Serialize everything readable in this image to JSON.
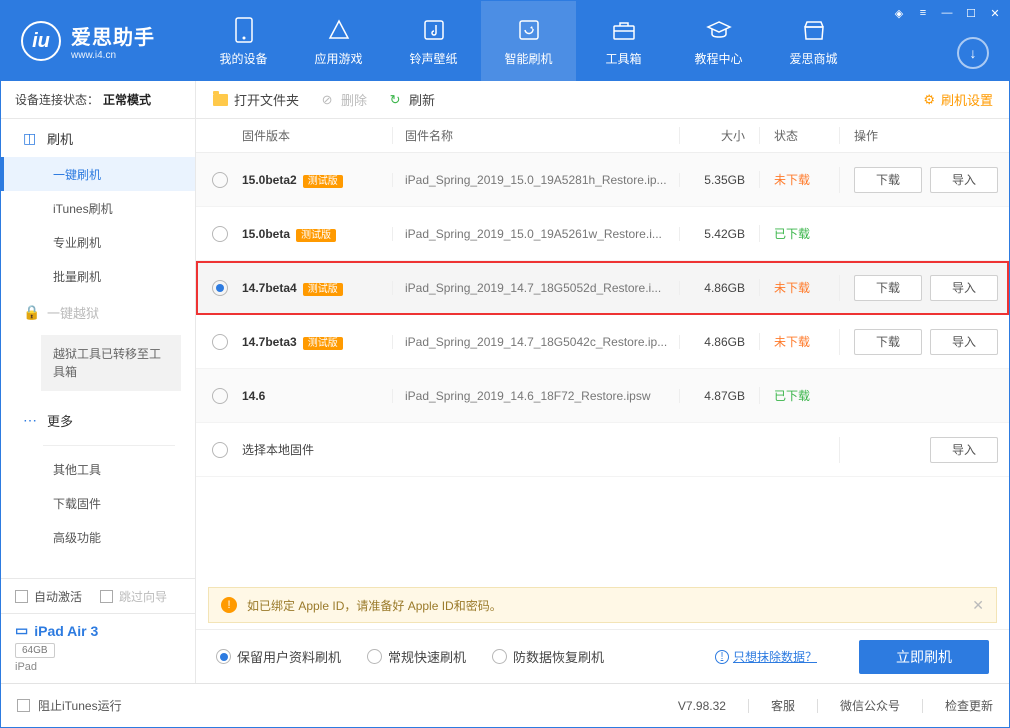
{
  "brand": {
    "title": "爱思助手",
    "subtitle": "www.i4.cn"
  },
  "nav": {
    "items": [
      {
        "label": "我的设备"
      },
      {
        "label": "应用游戏"
      },
      {
        "label": "铃声壁纸"
      },
      {
        "label": "智能刷机"
      },
      {
        "label": "工具箱"
      },
      {
        "label": "教程中心"
      },
      {
        "label": "爱思商城"
      }
    ]
  },
  "conn": {
    "label": "设备连接状态：",
    "value": "正常模式"
  },
  "sidebar": {
    "flash": {
      "title": "刷机",
      "items": [
        "一键刷机",
        "iTunes刷机",
        "专业刷机",
        "批量刷机"
      ]
    },
    "jailbreak": {
      "title": "一键越狱",
      "note": "越狱工具已转移至工具箱"
    },
    "more": {
      "title": "更多",
      "items": [
        "其他工具",
        "下载固件",
        "高级功能"
      ]
    },
    "auto_activate": "自动激活",
    "skip_guide": "跳过向导"
  },
  "device": {
    "name": "iPad Air 3",
    "capacity": "64GB",
    "type": "iPad"
  },
  "toolbar": {
    "open": "打开文件夹",
    "delete": "删除",
    "refresh": "刷新",
    "settings": "刷机设置"
  },
  "columns": {
    "version": "固件版本",
    "name": "固件名称",
    "size": "大小",
    "status": "状态",
    "ops": "操作"
  },
  "beta_tag": "测试版",
  "btn": {
    "download": "下载",
    "import": "导入"
  },
  "status": {
    "no": "未下载",
    "yes": "已下载"
  },
  "rows": [
    {
      "version": "15.0beta2",
      "beta": true,
      "name": "iPad_Spring_2019_15.0_19A5281h_Restore.ip...",
      "size": "5.35GB",
      "status": "no",
      "download": true,
      "import": true
    },
    {
      "version": "15.0beta",
      "beta": true,
      "name": "iPad_Spring_2019_15.0_19A5261w_Restore.i...",
      "size": "5.42GB",
      "status": "yes",
      "download": false,
      "import": false
    },
    {
      "version": "14.7beta4",
      "beta": true,
      "name": "iPad_Spring_2019_14.7_18G5052d_Restore.i...",
      "size": "4.86GB",
      "status": "no",
      "download": true,
      "import": true,
      "selected": true,
      "highlight": true
    },
    {
      "version": "14.7beta3",
      "beta": true,
      "name": "iPad_Spring_2019_14.7_18G5042c_Restore.ip...",
      "size": "4.86GB",
      "status": "no",
      "download": true,
      "import": true
    },
    {
      "version": "14.6",
      "beta": false,
      "name": "iPad_Spring_2019_14.6_18F72_Restore.ipsw",
      "size": "4.87GB",
      "status": "yes",
      "download": false,
      "import": false
    }
  ],
  "local_row": {
    "label": "选择本地固件"
  },
  "notice": "如已绑定 Apple ID，请准备好 Apple ID和密码。",
  "modes": {
    "keep": "保留用户资料刷机",
    "normal": "常规快速刷机",
    "recover": "防数据恢复刷机"
  },
  "erase_link": "只想抹除数据？",
  "flash_now": "立即刷机",
  "footer": {
    "block_itunes": "阻止iTunes运行",
    "version": "V7.98.32",
    "service": "客服",
    "wechat": "微信公众号",
    "update": "检查更新"
  }
}
